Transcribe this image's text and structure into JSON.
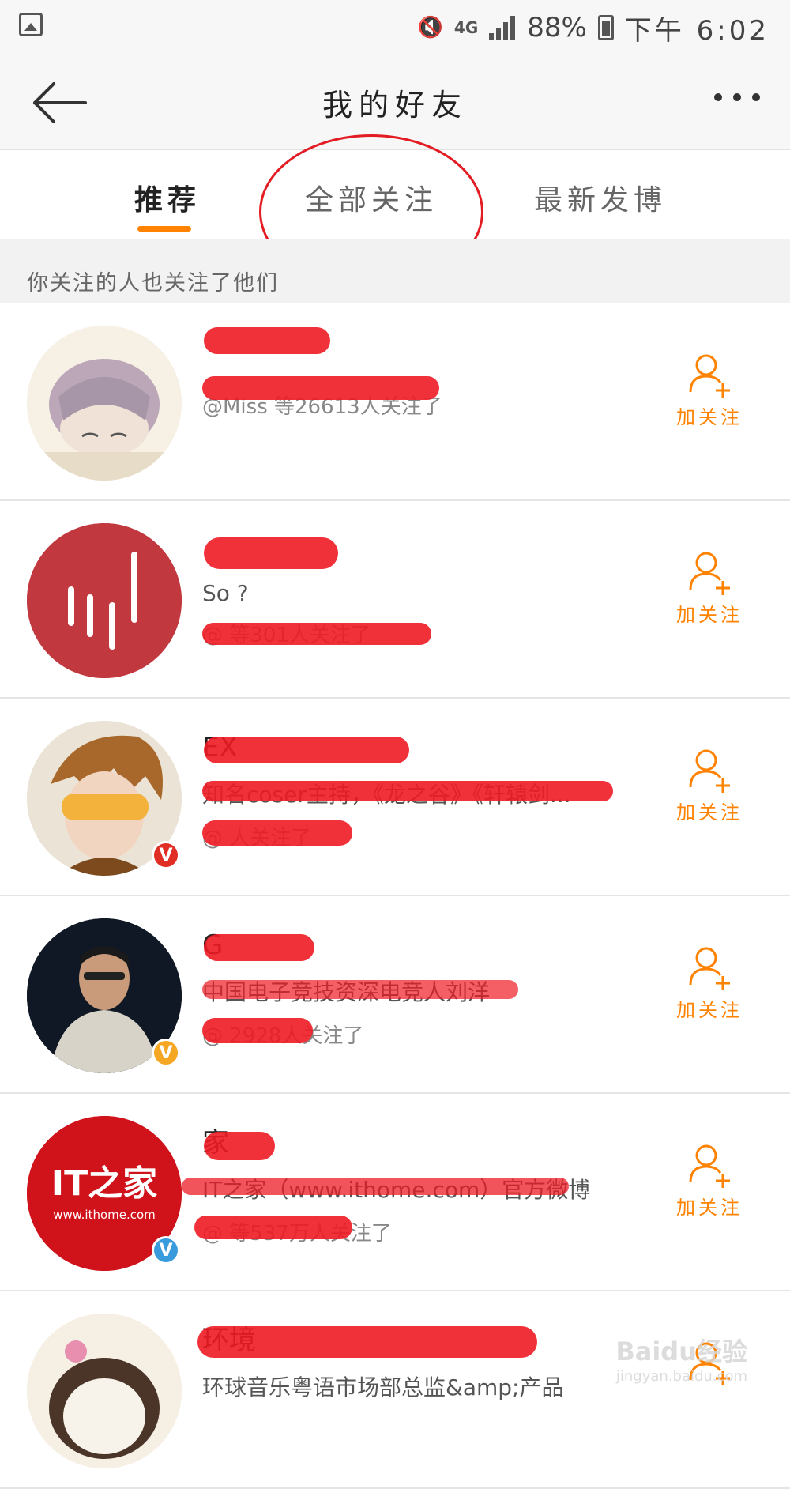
{
  "status_bar": {
    "network": "4G",
    "battery": "88%",
    "time": "下午 6:02"
  },
  "nav": {
    "title": "我的好友"
  },
  "tabs": [
    {
      "label": "推荐",
      "active": true
    },
    {
      "label": "全部关注",
      "active": false
    },
    {
      "label": "最新发博",
      "active": false
    }
  ],
  "section_header": "你关注的人也关注了他们",
  "follow_label": "加关注",
  "accent_color": "#ff8200",
  "users": [
    {
      "name": "",
      "bio": "",
      "followed_by": "@Miss 等26613人关注了",
      "verified": null
    },
    {
      "name": "",
      "bio": "So ?",
      "followed_by": "@ 等301人关注了",
      "verified": null
    },
    {
      "name": "EX",
      "bio": "知名coser主持，《龙之谷》《轩辕剑...",
      "followed_by": "@ 人关注了",
      "verified": "red"
    },
    {
      "name": "G",
      "bio": "中国电子竞技资深电竞人刘洋",
      "followed_by": "@ 2928人关注了",
      "verified": "yellow"
    },
    {
      "name": "家",
      "bio": "IT之家（www.ithome.com）官方微博",
      "followed_by": "@ 等537万人关注了",
      "verified": "blue"
    },
    {
      "name": "环境",
      "bio": "环球音乐粤语市场部总监&amp;产品",
      "followed_by": "",
      "verified": null
    }
  ],
  "ithome_logo_text": "IT之家",
  "ithome_url_text": "www.ithome.com",
  "watermark": {
    "text": "Baidu经验",
    "sub": "jingyan.baidu.com"
  }
}
